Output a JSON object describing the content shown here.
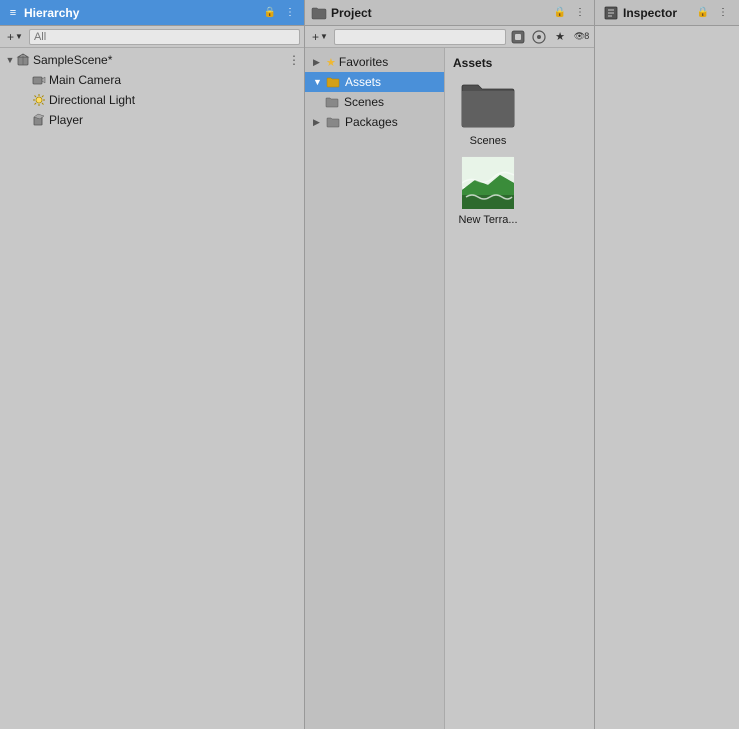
{
  "hierarchy": {
    "title": "Hierarchy",
    "search_placeholder": "All",
    "scene": {
      "name": "SampleScene*",
      "children": [
        {
          "name": "Main Camera",
          "icon": "camera"
        },
        {
          "name": "Directional Light",
          "icon": "light"
        },
        {
          "name": "Player",
          "icon": "cube"
        }
      ]
    }
  },
  "project": {
    "title": "Project",
    "sidebar": {
      "items": [
        {
          "label": "Favorites",
          "type": "favorites",
          "expanded": false
        },
        {
          "label": "Assets",
          "type": "folder",
          "expanded": true,
          "children": [
            {
              "label": "Scenes",
              "type": "folder"
            }
          ]
        },
        {
          "label": "Packages",
          "type": "folder",
          "expanded": false
        }
      ]
    },
    "assets_header": "Assets",
    "assets": [
      {
        "name": "Scenes",
        "type": "folder"
      },
      {
        "name": "New Terra...",
        "type": "terrain"
      }
    ]
  },
  "inspector": {
    "title": "Inspector"
  },
  "icons": {
    "hamburger": "≡",
    "lock": "🔒",
    "more": "⋮",
    "plus": "+",
    "chevron_down": "▼",
    "chevron_right": "▶",
    "search": "🔍",
    "eye": "👁",
    "layers": "⊕"
  }
}
